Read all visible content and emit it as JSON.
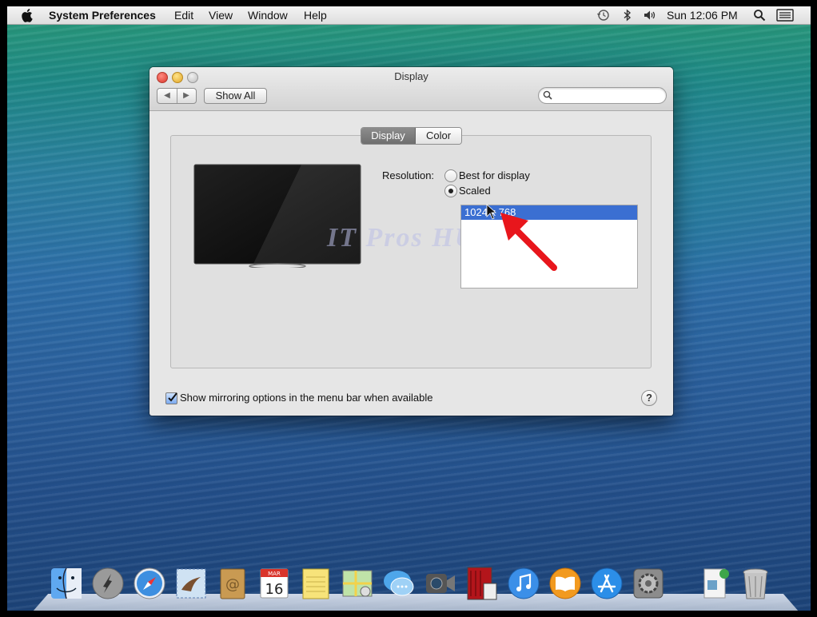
{
  "menubar": {
    "app_name": "System Preferences",
    "menus": [
      "Edit",
      "View",
      "Window",
      "Help"
    ],
    "clock": "Sun 12:06 PM",
    "status_icons": [
      "time-machine-icon",
      "bluetooth-icon",
      "volume-icon",
      "spotlight-icon",
      "notification-center-icon"
    ]
  },
  "window": {
    "title": "Display",
    "show_all_label": "Show All",
    "search": {
      "value": "",
      "placeholder": ""
    },
    "tabs": [
      {
        "label": "Display",
        "selected": true
      },
      {
        "label": "Color",
        "selected": false
      }
    ],
    "resolution": {
      "label": "Resolution:",
      "options": [
        {
          "label": "Best for display",
          "selected": false
        },
        {
          "label": "Scaled",
          "selected": true
        }
      ],
      "list_items": [
        {
          "label": "1024 x 768",
          "selected": true
        }
      ]
    },
    "mirroring_checkbox": {
      "label": "Show mirroring options in the menu bar when available",
      "checked": true
    },
    "help_label": "?"
  },
  "watermark": "IT Pros HUB",
  "dock": {
    "items": [
      "Finder",
      "Launchpad",
      "Safari",
      "Mail",
      "Contacts",
      "Calendar",
      "Notes",
      "Maps",
      "Messages",
      "FaceTime",
      "Photo Booth",
      "iTunes",
      "iBooks",
      "App Store",
      "System Preferences",
      "Documents",
      "Trash"
    ],
    "calendar_month": "MAR",
    "calendar_day": "16"
  },
  "colors": {
    "selection_blue": "#3b6fd2",
    "annotation_arrow": "#e8161c"
  }
}
